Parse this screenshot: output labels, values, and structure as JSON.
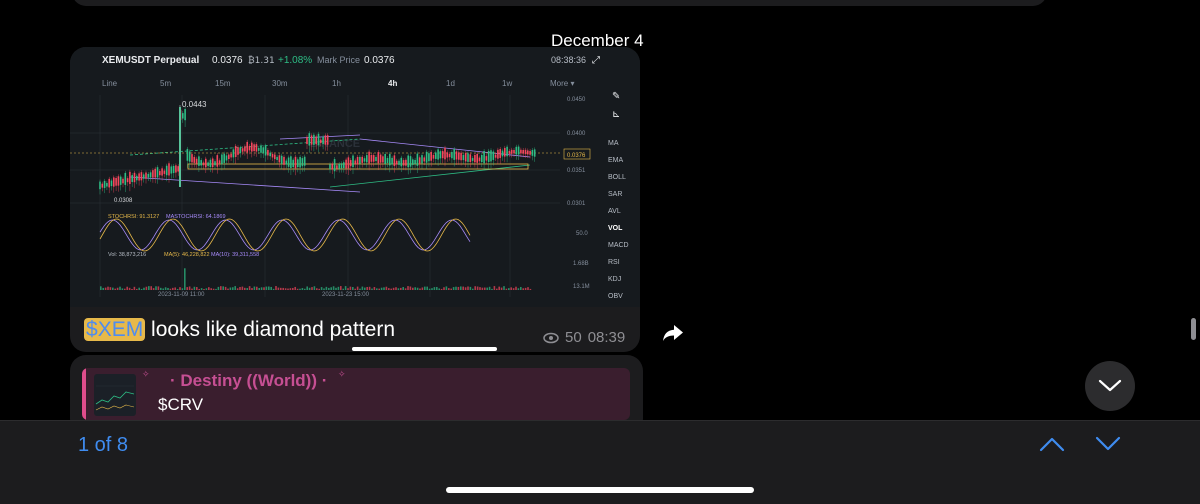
{
  "date_header": "December 4",
  "chart_card": {
    "symbol": "XEMUSDT Perpetual",
    "price": "0.0376",
    "volume": "₿1.31",
    "change": "+1.08%",
    "mark_label": "Mark Price",
    "mark_price": "0.0376",
    "time": "08:38:36",
    "timeframes": [
      "Line",
      "5m",
      "15m",
      "30m",
      "1h",
      "4h",
      "1d",
      "1w",
      "More ▾"
    ],
    "active_timeframe": "4h",
    "price_ticks": [
      "0.0450",
      "0.0400",
      "0.0351",
      "0.0301"
    ],
    "current_price_tag": "0.0376",
    "high_label": "0.0443",
    "low_label": "0.0308",
    "watermark": "BINANCE",
    "indicators": [
      "MA",
      "EMA",
      "BOLL",
      "SAR",
      "AVL",
      "VOL",
      "MACD",
      "RSI",
      "KDJ",
      "OBV"
    ],
    "active_indicator": "VOL",
    "stoch_label": "STOCHRSI: 91.3127",
    "mastoch_label": "MASTOCHRSI: 64.1869",
    "stoch_tick": "50.0",
    "vol_label": "Vol: 38,873,216",
    "ma5_label": "MA(5): 46,228,822",
    "ma10_label": "MA(10): 39,311,558",
    "vol_ticks": [
      "1.68B",
      "13.1M"
    ],
    "date_labels": [
      "2023-11-09 11:00",
      "2023-11-23 15:00"
    ]
  },
  "message": {
    "cashtag_symbol": "$",
    "cashtag_name": "XEM",
    "text": " looks like diamond pattern",
    "views": "50",
    "time": "08:39"
  },
  "quoted": {
    "author": "· Destiny ((World)) ·",
    "text": "$CRV"
  },
  "search_nav": {
    "counter": "1 of 8"
  },
  "colors": {
    "accent_blue": "#3f8cf0",
    "highlight": "#e7b94a",
    "author_pink": "#c64f93",
    "green": "#2ebd85",
    "red": "#f6465d"
  }
}
